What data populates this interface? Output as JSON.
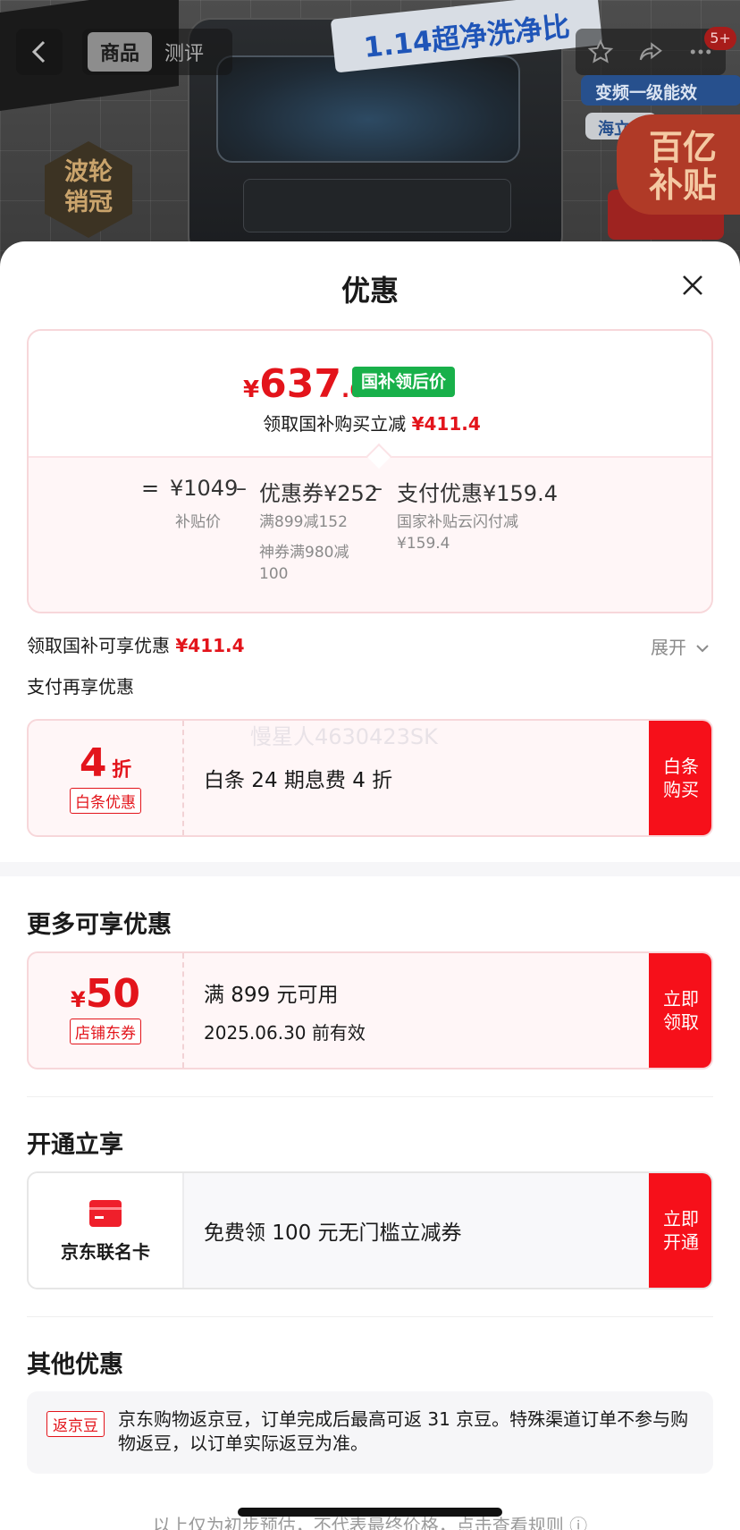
{
  "header": {
    "back_icon": "chevron-left-icon",
    "tabs": [
      "商品",
      "测评"
    ],
    "banner_text": "1.14超净洗净比",
    "badge_text": [
      "波轮",
      "销冠"
    ],
    "chip_blue": "变频一级能效",
    "chip_white": "海立",
    "subsidy_text": [
      "百亿",
      "补贴"
    ],
    "cart_badge": "5+"
  },
  "sheet": {
    "title": "优惠",
    "close_icon": "close-icon"
  },
  "price": {
    "currency": "¥",
    "integer": "637",
    "decimal": ".6",
    "tag": "国补领后价",
    "claim_text": "领取国补购买立减",
    "claim_amount": "¥411.4",
    "breakdown": {
      "eq": "=",
      "base": "¥1049",
      "base_label": "补贴价",
      "minus": "–",
      "coupon": "优惠券¥252",
      "coupon_notes": [
        "满899减152",
        "神券满980减",
        "100"
      ],
      "pay": "支付优惠¥159.4",
      "pay_notes": [
        "国家补贴云闪付减",
        "¥159.4"
      ]
    }
  },
  "subsidy_row": {
    "label": "领取国补可享优惠",
    "amount": "¥411.4",
    "expand": "展开"
  },
  "pay_section": {
    "title": "支付再享优惠",
    "coupon": {
      "value": "4",
      "unit": "折",
      "chip": "白条优惠",
      "text": "白条 24 期息费 4 折",
      "action": "白条购买"
    }
  },
  "watermark": "慢星人4630423SK",
  "more_section": {
    "title": "更多可享优惠",
    "coupon": {
      "currency": "¥",
      "value": "50",
      "chip": "店铺东券",
      "text": "满 899 元可用",
      "sub": "2025.06.30 前有效",
      "action": "立即领取"
    }
  },
  "open_section": {
    "title": "开通立享",
    "coupon": {
      "card_icon": "credit-card-icon",
      "name": "京东联名卡",
      "text": "免费领 100 元无门槛立减券",
      "action": "立即开通"
    }
  },
  "other_section": {
    "title": "其他优惠",
    "chip": "返京豆",
    "text": "京东购物返京豆，订单完成后最高可返 31 京豆。特殊渠道订单不参与购物返豆，以订单实际返豆为准。"
  },
  "footer_note": "以上仅为初步预估，不代表最终价格，点击查看规则 ⓘ",
  "colors": {
    "accent": "#e3141b",
    "action": "#f6101a",
    "green_tag": "#18b04a"
  }
}
